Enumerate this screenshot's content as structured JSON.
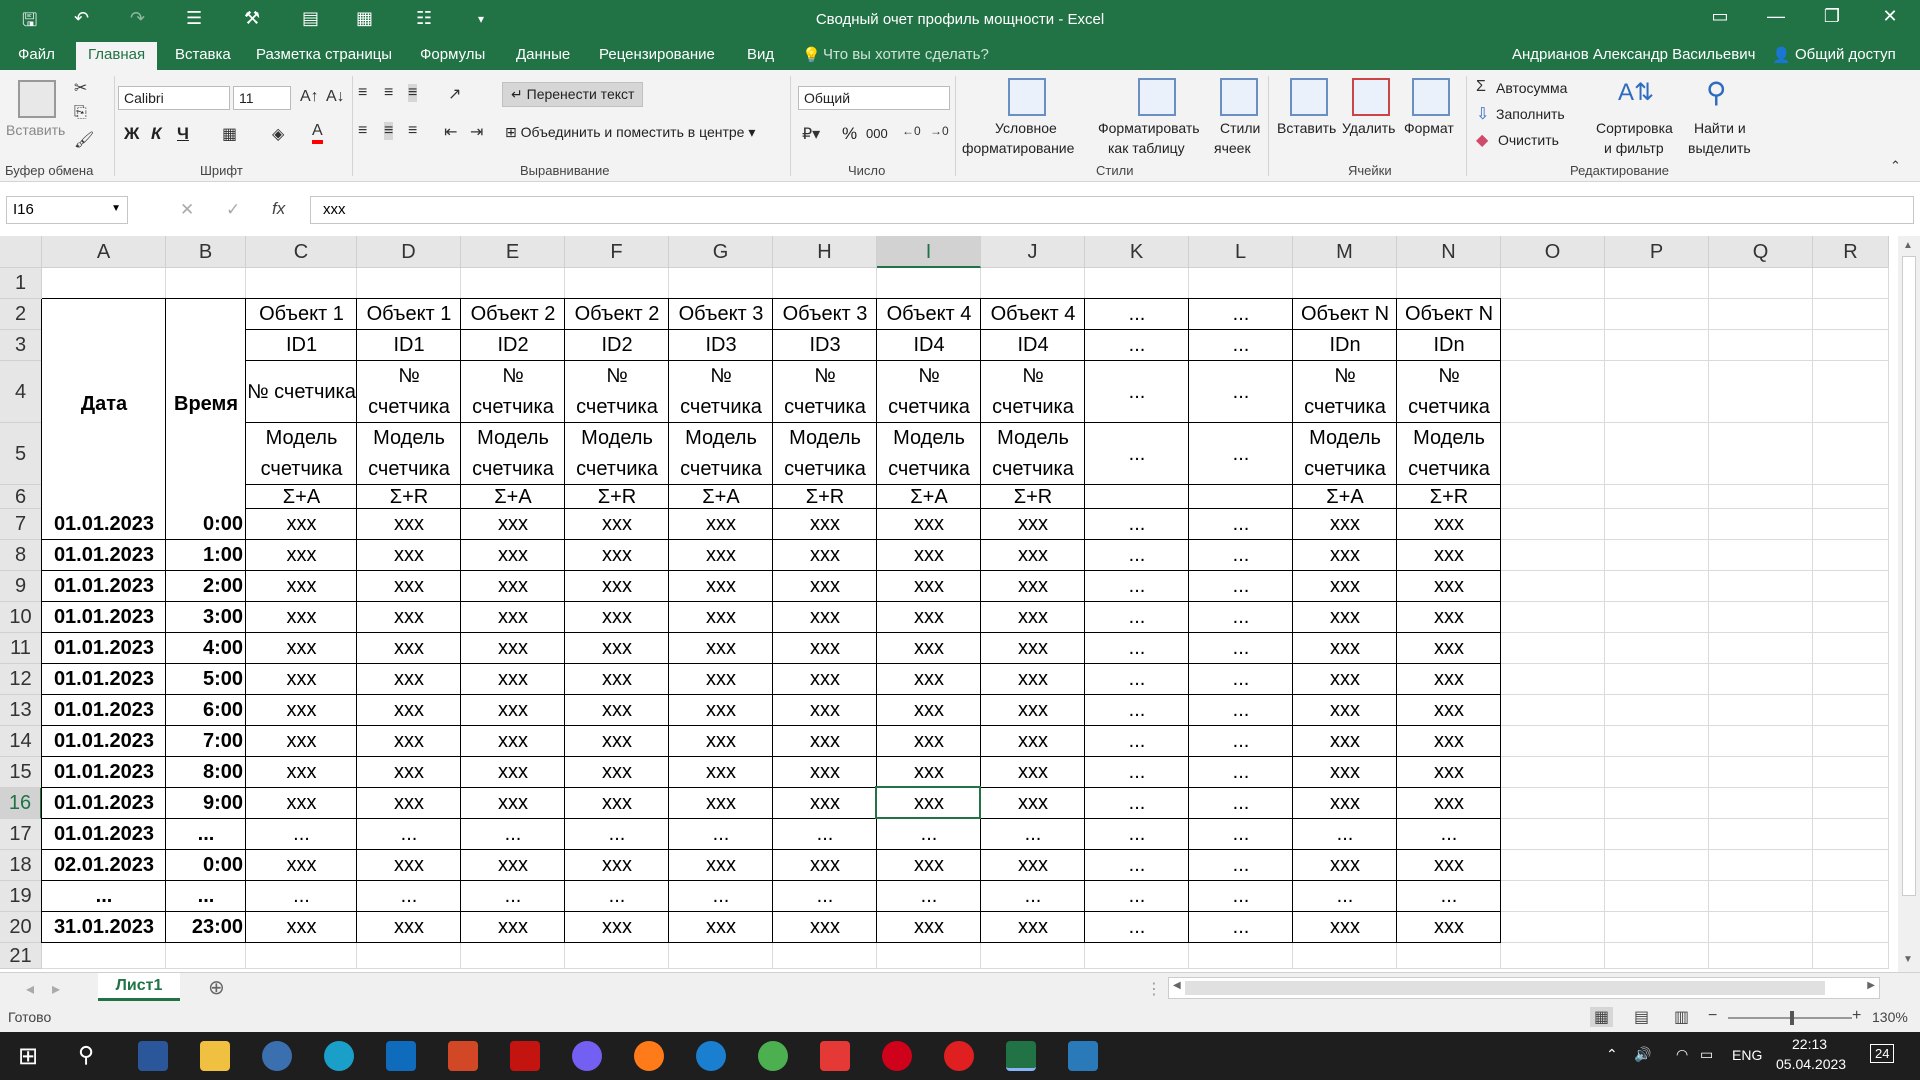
{
  "window": {
    "title": "Сводный очет профиль мощности - Excel",
    "controls": [
      "restore-icon",
      "minimize-icon",
      "maximize-icon",
      "close-icon"
    ]
  },
  "ribbon_tabs": [
    "Файл",
    "Главная",
    "Вставка",
    "Разметка страницы",
    "Формулы",
    "Данные",
    "Рецензирование",
    "Вид"
  ],
  "active_tab": "Главная",
  "tell_me": "Что вы хотите сделать?",
  "user": "Андрианов Александр Васильевич",
  "share": "Общий доступ",
  "ribbon": {
    "clipboard": {
      "paste": "Вставить",
      "label": "Буфер обмена"
    },
    "font": {
      "name": "Calibri",
      "size": "11",
      "label": "Шрифт",
      "bold": "Ж",
      "italic": "К",
      "underline": "Ч",
      "color": "#ff0000"
    },
    "alignment": {
      "wrap": "Перенести текст",
      "merge": "Объединить и поместить в центре",
      "label": "Выравнивание"
    },
    "number": {
      "format": "Общий",
      "label": "Число",
      "percent": "%",
      "thousands": "000"
    },
    "styles": {
      "conditional_l1": "Условное",
      "conditional_l2": "форматирование",
      "as_table_l1": "Форматировать",
      "as_table_l2": "как таблицу",
      "cell_styles_l1": "Стили",
      "cell_styles_l2": "ячеек",
      "label": "Стили"
    },
    "cells": {
      "insert": "Вставить",
      "delete": "Удалить",
      "format": "Формат",
      "label": "Ячейки"
    },
    "editing": {
      "autosum": "Автосумма",
      "fill": "Заполнить",
      "clear": "Очистить",
      "sort_l1": "Сортировка",
      "sort_l2": "и фильтр",
      "find_l1": "Найти и",
      "find_l2": "выделить",
      "label": "Редактирование"
    }
  },
  "formula_bar": {
    "name_box": "I16",
    "fx": "fx",
    "formula": "xxx"
  },
  "columns": [
    "A",
    "B",
    "C",
    "D",
    "E",
    "F",
    "G",
    "H",
    "I",
    "J",
    "K",
    "L",
    "M",
    "N",
    "O",
    "P",
    "Q",
    "R"
  ],
  "rows": [
    "1",
    "2",
    "3",
    "4",
    "5",
    "6",
    "7",
    "8",
    "9",
    "10",
    "11",
    "12",
    "13",
    "14",
    "15",
    "16",
    "17",
    "18",
    "19",
    "20",
    "21"
  ],
  "selected": {
    "col": "I",
    "row": "16"
  },
  "sheet": {
    "header_date": "Дата",
    "header_time": "Время",
    "objects": [
      "Объект 1",
      "Объект 1",
      "Объект 2",
      "Объект 2",
      "Объект 3",
      "Объект 3",
      "Объект 4",
      "Объект 4",
      "...",
      "...",
      "Объект N",
      "Объект N"
    ],
    "ids": [
      "ID1",
      "ID1",
      "ID2",
      "ID2",
      "ID3",
      "ID3",
      "ID4",
      "ID4",
      "...",
      "...",
      "IDn",
      "IDn"
    ],
    "meters": [
      "№ счетчика",
      "№ счетчика",
      "№ счетчика",
      "№ счетчика",
      "№ счетчика",
      "№ счетчика",
      "№ счетчика",
      "№ счетчика",
      "...",
      "...",
      "№ счетчика",
      "№ счетчика"
    ],
    "models": [
      "Модель счетчика",
      "Модель счетчика",
      "Модель счетчика",
      "Модель счетчика",
      "Модель счетчика",
      "Модель счетчика",
      "Модель счетчика",
      "Модель счетчика",
      "...",
      "...",
      "Модель счетчика",
      "Модель счетчика"
    ],
    "sums": [
      "Σ+A",
      "Σ+R",
      "Σ+A",
      "Σ+R",
      "Σ+A",
      "Σ+R",
      "Σ+A",
      "Σ+R",
      "",
      "",
      "Σ+A",
      "Σ+R"
    ],
    "data_rows": [
      {
        "date": "01.01.2023",
        "time": "0:00",
        "values": [
          "xxx",
          "xxx",
          "xxx",
          "xxx",
          "xxx",
          "xxx",
          "xxx",
          "xxx",
          "...",
          "...",
          "xxx",
          "xxx"
        ]
      },
      {
        "date": "01.01.2023",
        "time": "1:00",
        "values": [
          "xxx",
          "xxx",
          "xxx",
          "xxx",
          "xxx",
          "xxx",
          "xxx",
          "xxx",
          "...",
          "...",
          "xxx",
          "xxx"
        ]
      },
      {
        "date": "01.01.2023",
        "time": "2:00",
        "values": [
          "xxx",
          "xxx",
          "xxx",
          "xxx",
          "xxx",
          "xxx",
          "xxx",
          "xxx",
          "...",
          "...",
          "xxx",
          "xxx"
        ]
      },
      {
        "date": "01.01.2023",
        "time": "3:00",
        "values": [
          "xxx",
          "xxx",
          "xxx",
          "xxx",
          "xxx",
          "xxx",
          "xxx",
          "xxx",
          "...",
          "...",
          "xxx",
          "xxx"
        ]
      },
      {
        "date": "01.01.2023",
        "time": "4:00",
        "values": [
          "xxx",
          "xxx",
          "xxx",
          "xxx",
          "xxx",
          "xxx",
          "xxx",
          "xxx",
          "...",
          "...",
          "xxx",
          "xxx"
        ]
      },
      {
        "date": "01.01.2023",
        "time": "5:00",
        "values": [
          "xxx",
          "xxx",
          "xxx",
          "xxx",
          "xxx",
          "xxx",
          "xxx",
          "xxx",
          "...",
          "...",
          "xxx",
          "xxx"
        ]
      },
      {
        "date": "01.01.2023",
        "time": "6:00",
        "values": [
          "xxx",
          "xxx",
          "xxx",
          "xxx",
          "xxx",
          "xxx",
          "xxx",
          "xxx",
          "...",
          "...",
          "xxx",
          "xxx"
        ]
      },
      {
        "date": "01.01.2023",
        "time": "7:00",
        "values": [
          "xxx",
          "xxx",
          "xxx",
          "xxx",
          "xxx",
          "xxx",
          "xxx",
          "xxx",
          "...",
          "...",
          "xxx",
          "xxx"
        ]
      },
      {
        "date": "01.01.2023",
        "time": "8:00",
        "values": [
          "xxx",
          "xxx",
          "xxx",
          "xxx",
          "xxx",
          "xxx",
          "xxx",
          "xxx",
          "...",
          "...",
          "xxx",
          "xxx"
        ]
      },
      {
        "date": "01.01.2023",
        "time": "9:00",
        "values": [
          "xxx",
          "xxx",
          "xxx",
          "xxx",
          "xxx",
          "xxx",
          "xxx",
          "xxx",
          "...",
          "...",
          "xxx",
          "xxx"
        ]
      },
      {
        "date": "01.01.2023",
        "time": "...",
        "values": [
          "...",
          "...",
          "...",
          "...",
          "...",
          "...",
          "...",
          "...",
          "...",
          "...",
          "...",
          "..."
        ]
      },
      {
        "date": "02.01.2023",
        "time": "0:00",
        "values": [
          "xxx",
          "xxx",
          "xxx",
          "xxx",
          "xxx",
          "xxx",
          "xxx",
          "xxx",
          "...",
          "...",
          "xxx",
          "xxx"
        ]
      },
      {
        "date": "...",
        "time": "...",
        "values": [
          "...",
          "...",
          "...",
          "...",
          "...",
          "...",
          "...",
          "...",
          "...",
          "...",
          "...",
          "..."
        ]
      },
      {
        "date": "31.01.2023",
        "time": "23:00",
        "values": [
          "xxx",
          "xxx",
          "xxx",
          "xxx",
          "xxx",
          "xxx",
          "xxx",
          "xxx",
          "...",
          "...",
          "xxx",
          "xxx"
        ]
      }
    ]
  },
  "sheet_tab": "Лист1",
  "status": {
    "ready": "Готово",
    "zoom": "130%"
  },
  "taskbar": {
    "lang": "ENG",
    "time": "22:13",
    "date": "05.04.2023",
    "notifications": "24"
  }
}
